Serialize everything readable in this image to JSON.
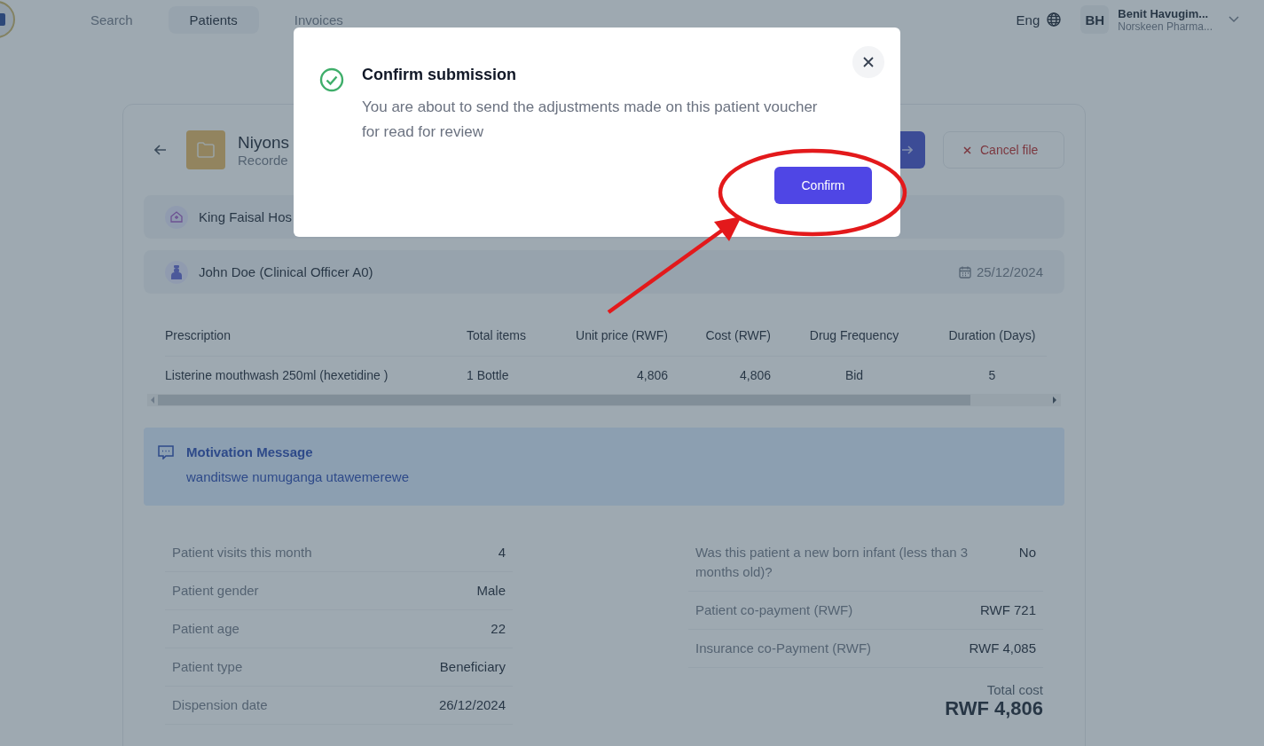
{
  "nav": {
    "tabs": [
      {
        "label": "Search",
        "selected": false
      },
      {
        "label": "Patients",
        "selected": true
      },
      {
        "label": "Invoices",
        "selected": false
      }
    ],
    "language": "Eng",
    "user": {
      "initials": "BH",
      "name": "Benit Havugim...",
      "org": "Norskeen Pharma..."
    }
  },
  "patient": {
    "name": "Niyons",
    "subtitle": "Recorde",
    "cancel_button": "Cancel file"
  },
  "facility": "King Faisal Hos",
  "doctor": {
    "name": "John Doe (Clinical Officer A0)",
    "date": "25/12/2024"
  },
  "table": {
    "columns": [
      "Prescription",
      "Total items",
      "Unit price (RWF)",
      "Cost (RWF)",
      "Drug Frequency",
      "Duration (Days)"
    ],
    "rows": [
      [
        "Listerine mouthwash 250ml (hexetidine )",
        "1 Bottle",
        "4,806",
        "4,806",
        "Bid",
        "5"
      ]
    ]
  },
  "motivation": {
    "title": "Motivation Message",
    "text": "wanditswe numuganga utawemerewe"
  },
  "details_left": [
    {
      "label": "Patient visits this month",
      "value": "4"
    },
    {
      "label": "Patient gender",
      "value": "Male"
    },
    {
      "label": "Patient age",
      "value": "22"
    },
    {
      "label": "Patient type",
      "value": "Beneficiary"
    },
    {
      "label": "Dispension date",
      "value": "26/12/2024"
    }
  ],
  "details_right": [
    {
      "label": "Was this patient a new born infant (less than 3 months old)?",
      "value": "No"
    },
    {
      "label": "Patient co-payment (RWF)",
      "value": "RWF 721"
    },
    {
      "label": "Insurance co-Payment (RWF)",
      "value": "RWF 4,085"
    }
  ],
  "total": {
    "label": "Total cost",
    "value": "RWF 4,806"
  },
  "modal": {
    "title": "Confirm submission",
    "message": "You are about to send the adjustments made on this patient voucher for read for review",
    "confirm_button": "Confirm"
  }
}
